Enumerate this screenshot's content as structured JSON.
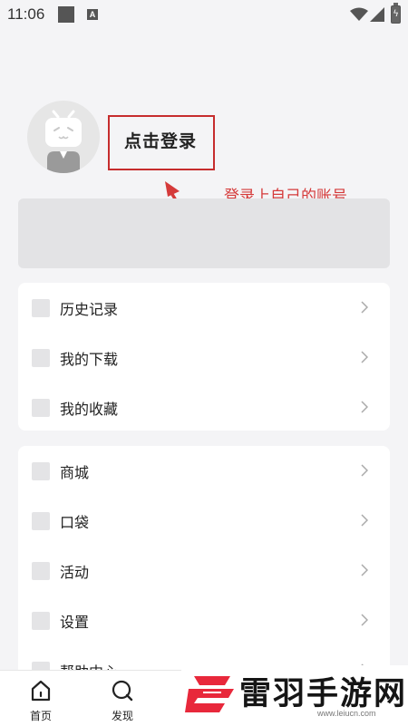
{
  "status_bar": {
    "time": "11:06",
    "badge_letter": "A"
  },
  "profile": {
    "login_label": "点击登录"
  },
  "annotation": {
    "text": "登录上自己的账号",
    "color": "#d53a3a"
  },
  "menu_group_1": [
    {
      "label": "历史记录"
    },
    {
      "label": "我的下载"
    },
    {
      "label": "我的收藏"
    }
  ],
  "menu_group_2": [
    {
      "label": "商城"
    },
    {
      "label": "口袋"
    },
    {
      "label": "活动"
    },
    {
      "label": "设置"
    },
    {
      "label": "帮助中心"
    }
  ],
  "bottom_nav": [
    {
      "label": "首页",
      "icon": "home-icon"
    },
    {
      "label": "发现",
      "icon": "discover-icon"
    }
  ],
  "watermark": {
    "title": "雷羽手游网",
    "url": "www.leiucn.com"
  },
  "colors": {
    "accent_red": "#c62d2d",
    "background": "#f4f4f6"
  }
}
